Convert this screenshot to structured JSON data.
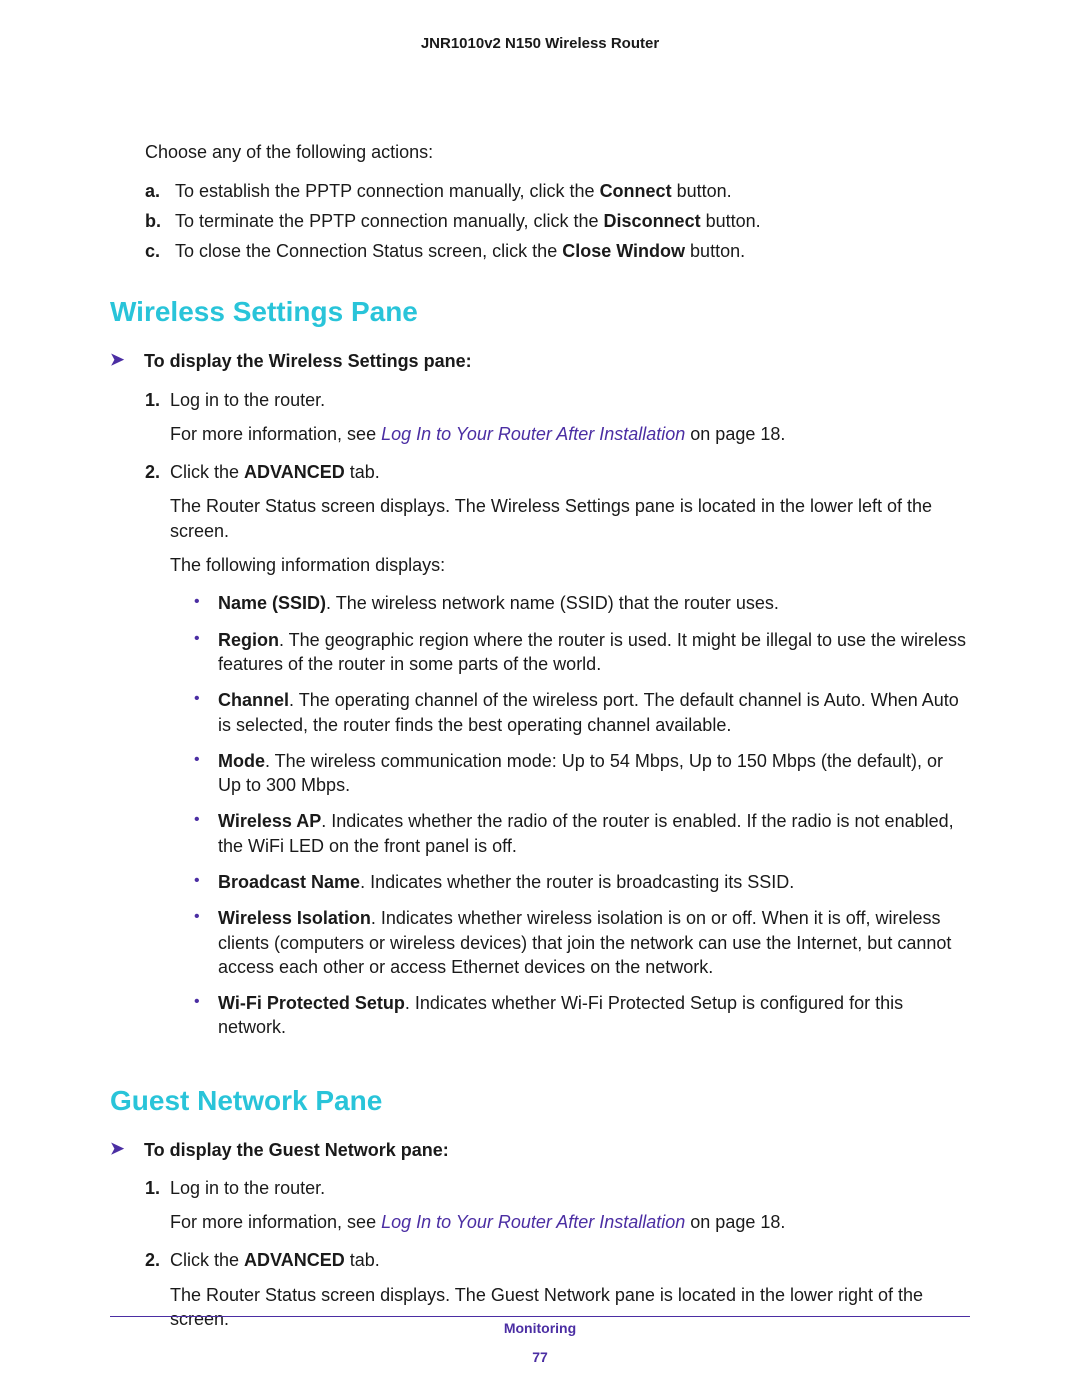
{
  "header": {
    "product": "JNR1010v2 N150 Wireless Router"
  },
  "intro": "Choose any of the following actions:",
  "actions": [
    {
      "label": "a.",
      "pre": "To establish the PPTP connection manually, click the ",
      "bold": "Connect",
      "post": " button."
    },
    {
      "label": "b.",
      "pre": "To terminate the PPTP connection manually, click the ",
      "bold": "Disconnect",
      "post": " button."
    },
    {
      "label": "c.",
      "pre": "To close the Connection Status screen, click the ",
      "bold": "Close Window",
      "post": " button."
    }
  ],
  "section1": {
    "title": "Wireless Settings Pane",
    "proc_title": "To display the Wireless Settings pane:",
    "step1": {
      "num": "1.",
      "text": "Log in to the router.",
      "more_pre": "For more information, see ",
      "more_link": "Log In to Your Router After Installation",
      "more_post": " on page 18."
    },
    "step2": {
      "num": "2.",
      "pre": "Click the ",
      "bold": "ADVANCED",
      "post": " tab.",
      "body": "The Router Status screen displays. The Wireless Settings pane is located in the lower left of the screen.",
      "body2": "The following information displays:"
    },
    "bullets": [
      {
        "term": "Name (SSID)",
        "desc": ". The wireless network name (SSID) that the router uses."
      },
      {
        "term": "Region",
        "desc": ". The geographic region where the router is used. It might be illegal to use the wireless features of the router in some parts of the world."
      },
      {
        "term": "Channel",
        "desc": ". The operating channel of the wireless port. The default channel is Auto. When Auto is selected, the router finds the best operating channel available."
      },
      {
        "term": "Mode",
        "desc": ". The wireless communication mode: Up to 54 Mbps, Up to 150 Mbps (the default), or Up to 300 Mbps."
      },
      {
        "term": "Wireless AP",
        "desc": ". Indicates whether the radio of the router is enabled. If the radio is not enabled, the WiFi LED on the front panel is off."
      },
      {
        "term": "Broadcast Name",
        "desc": ". Indicates whether the router is broadcasting its SSID."
      },
      {
        "term": "Wireless Isolation",
        "desc": ". Indicates whether wireless isolation is on or off. When it is off, wireless clients (computers or wireless devices) that join the network can use the Internet, but cannot access each other or access Ethernet devices on the network."
      },
      {
        "term": "Wi-Fi Protected Setup",
        "desc": ". Indicates whether Wi-Fi Protected Setup is configured for this network."
      }
    ]
  },
  "section2": {
    "title": "Guest Network Pane",
    "proc_title": "To display the Guest Network pane:",
    "step1": {
      "num": "1.",
      "text": "Log in to the router.",
      "more_pre": "For more information, see ",
      "more_link": "Log In to Your Router After Installation",
      "more_post": " on page 18."
    },
    "step2": {
      "num": "2.",
      "pre": "Click the ",
      "bold": "ADVANCED",
      "post": " tab.",
      "body": "The Router Status screen displays. The Guest Network pane is located in the lower right of the screen."
    }
  },
  "footer": {
    "section": "Monitoring",
    "page": "77"
  }
}
